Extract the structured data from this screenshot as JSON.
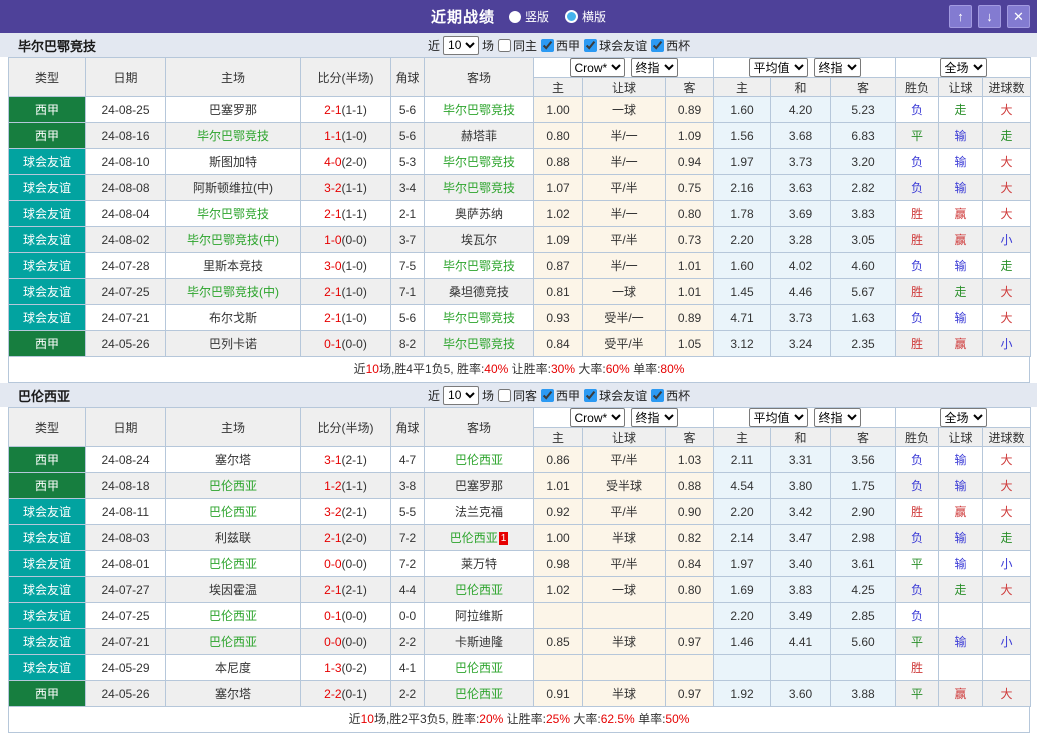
{
  "titlebar": {
    "title": "近期战绩",
    "view_options": [
      {
        "label": "竖版",
        "selected": true
      },
      {
        "label": "横版",
        "selected": false
      }
    ],
    "buttons": {
      "up": "↑",
      "down": "↓",
      "close": "✕"
    }
  },
  "table_header": {
    "static_cols": [
      "类型",
      "日期",
      "主场",
      "比分(半场)",
      "角球",
      "客场"
    ],
    "odds_source": "Crow*",
    "odds_stage": "终指",
    "avg_source": "平均值",
    "avg_stage": "终指",
    "scope": "全场",
    "odds_cols": [
      "主",
      "让球",
      "客"
    ],
    "avg_cols": [
      "主",
      "和",
      "客"
    ],
    "result_cols": [
      "胜负",
      "让球",
      "进球数"
    ]
  },
  "colors": {
    "accent_bar": "#4e4199",
    "type_badge": {
      "西甲": "#177e3f",
      "球会友谊": "#02a3a0"
    },
    "team_highlight": "#2ca42c",
    "score_red": "#e60000"
  },
  "sections": [
    {
      "team": "毕尔巴鄂竞技",
      "filter": {
        "near": "近",
        "count": "10",
        "unit": "场",
        "venue": {
          "label": "同主",
          "checked": false
        },
        "leagues": [
          {
            "label": "西甲",
            "checked": true
          },
          {
            "label": "球会友谊",
            "checked": true
          },
          {
            "label": "西杯",
            "checked": true
          }
        ]
      },
      "rows": [
        {
          "type": "西甲",
          "date": "24-08-25",
          "home": "巴塞罗那",
          "home_hl": false,
          "score": "2-1",
          "half": "(1-1)",
          "corner": "5-6",
          "away": "毕尔巴鄂竞技",
          "away_hl": true,
          "odds": [
            "1.00",
            "一球",
            "0.89"
          ],
          "avg": [
            "1.60",
            "4.20",
            "5.23"
          ],
          "results": [
            [
              "负",
              "blue"
            ],
            [
              "走",
              "green"
            ],
            [
              "大",
              "red"
            ]
          ]
        },
        {
          "type": "西甲",
          "date": "24-08-16",
          "home": "毕尔巴鄂竞技",
          "home_hl": true,
          "score": "1-1",
          "half": "(1-0)",
          "corner": "5-6",
          "away": "赫塔菲",
          "away_hl": false,
          "odds": [
            "0.80",
            "半/一",
            "1.09"
          ],
          "avg": [
            "1.56",
            "3.68",
            "6.83"
          ],
          "results": [
            [
              "平",
              "green"
            ],
            [
              "输",
              "blue"
            ],
            [
              "走",
              "green"
            ]
          ]
        },
        {
          "type": "球会友谊",
          "date": "24-08-10",
          "home": "斯图加特",
          "home_hl": false,
          "score": "4-0",
          "half": "(2-0)",
          "corner": "5-3",
          "away": "毕尔巴鄂竞技",
          "away_hl": true,
          "odds": [
            "0.88",
            "半/一",
            "0.94"
          ],
          "avg": [
            "1.97",
            "3.73",
            "3.20"
          ],
          "results": [
            [
              "负",
              "blue"
            ],
            [
              "输",
              "blue"
            ],
            [
              "大",
              "red"
            ]
          ]
        },
        {
          "type": "球会友谊",
          "date": "24-08-08",
          "home": "阿斯顿维拉(中)",
          "home_hl": false,
          "score": "3-2",
          "half": "(1-1)",
          "corner": "3-4",
          "away": "毕尔巴鄂竞技",
          "away_hl": true,
          "odds": [
            "1.07",
            "平/半",
            "0.75"
          ],
          "avg": [
            "2.16",
            "3.63",
            "2.82"
          ],
          "results": [
            [
              "负",
              "blue"
            ],
            [
              "输",
              "blue"
            ],
            [
              "大",
              "red"
            ]
          ]
        },
        {
          "type": "球会友谊",
          "date": "24-08-04",
          "home": "毕尔巴鄂竞技",
          "home_hl": true,
          "score": "2-1",
          "half": "(1-1)",
          "corner": "2-1",
          "away": "奥萨苏纳",
          "away_hl": false,
          "odds": [
            "1.02",
            "半/一",
            "0.80"
          ],
          "avg": [
            "1.78",
            "3.69",
            "3.83"
          ],
          "results": [
            [
              "胜",
              "red"
            ],
            [
              "赢",
              "red"
            ],
            [
              "大",
              "red"
            ]
          ]
        },
        {
          "type": "球会友谊",
          "date": "24-08-02",
          "home": "毕尔巴鄂竞技(中)",
          "home_hl": true,
          "score": "1-0",
          "half": "(0-0)",
          "corner": "3-7",
          "away": "埃瓦尔",
          "away_hl": false,
          "odds": [
            "1.09",
            "平/半",
            "0.73"
          ],
          "avg": [
            "2.20",
            "3.28",
            "3.05"
          ],
          "results": [
            [
              "胜",
              "red"
            ],
            [
              "赢",
              "red"
            ],
            [
              "小",
              "blue"
            ]
          ]
        },
        {
          "type": "球会友谊",
          "date": "24-07-28",
          "home": "里斯本竞技",
          "home_hl": false,
          "score": "3-0",
          "half": "(1-0)",
          "corner": "7-5",
          "away": "毕尔巴鄂竞技",
          "away_hl": true,
          "odds": [
            "0.87",
            "半/一",
            "1.01"
          ],
          "avg": [
            "1.60",
            "4.02",
            "4.60"
          ],
          "results": [
            [
              "负",
              "blue"
            ],
            [
              "输",
              "blue"
            ],
            [
              "走",
              "green"
            ]
          ]
        },
        {
          "type": "球会友谊",
          "date": "24-07-25",
          "home": "毕尔巴鄂竞技(中)",
          "home_hl": true,
          "score": "2-1",
          "half": "(1-0)",
          "corner": "7-1",
          "away": "桑坦德竞技",
          "away_hl": false,
          "odds": [
            "0.81",
            "一球",
            "1.01"
          ],
          "avg": [
            "1.45",
            "4.46",
            "5.67"
          ],
          "results": [
            [
              "胜",
              "red"
            ],
            [
              "走",
              "green"
            ],
            [
              "大",
              "red"
            ]
          ]
        },
        {
          "type": "球会友谊",
          "date": "24-07-21",
          "home": "布尔戈斯",
          "home_hl": false,
          "score": "2-1",
          "half": "(1-0)",
          "corner": "5-6",
          "away": "毕尔巴鄂竞技",
          "away_hl": true,
          "odds": [
            "0.93",
            "受半/一",
            "0.89"
          ],
          "avg": [
            "4.71",
            "3.73",
            "1.63"
          ],
          "results": [
            [
              "负",
              "blue"
            ],
            [
              "输",
              "blue"
            ],
            [
              "大",
              "red"
            ]
          ]
        },
        {
          "type": "西甲",
          "date": "24-05-26",
          "home": "巴列卡诺",
          "home_hl": false,
          "score": "0-1",
          "half": "(0-0)",
          "corner": "8-2",
          "away": "毕尔巴鄂竞技",
          "away_hl": true,
          "odds": [
            "0.84",
            "受平/半",
            "1.05"
          ],
          "avg": [
            "3.12",
            "3.24",
            "2.35"
          ],
          "results": [
            [
              "胜",
              "red"
            ],
            [
              "赢",
              "red"
            ],
            [
              "小",
              "blue"
            ]
          ]
        }
      ],
      "summary": [
        [
          "近",
          false
        ],
        [
          "10",
          true
        ],
        [
          "场,胜4平1负5, 胜率:",
          false
        ],
        [
          "40%",
          true
        ],
        [
          " 让胜率:",
          false
        ],
        [
          "30%",
          true
        ],
        [
          " 大率:",
          false
        ],
        [
          "60%",
          true
        ],
        [
          " 单率:",
          false
        ],
        [
          "80%",
          true
        ]
      ]
    },
    {
      "team": "巴伦西亚",
      "filter": {
        "near": "近",
        "count": "10",
        "unit": "场",
        "venue": {
          "label": "同客",
          "checked": false
        },
        "leagues": [
          {
            "label": "西甲",
            "checked": true
          },
          {
            "label": "球会友谊",
            "checked": true
          },
          {
            "label": "西杯",
            "checked": true
          }
        ]
      },
      "rows": [
        {
          "type": "西甲",
          "date": "24-08-24",
          "home": "塞尔塔",
          "home_hl": false,
          "score": "3-1",
          "half": "(2-1)",
          "corner": "4-7",
          "away": "巴伦西亚",
          "away_hl": true,
          "odds": [
            "0.86",
            "平/半",
            "1.03"
          ],
          "avg": [
            "2.11",
            "3.31",
            "3.56"
          ],
          "results": [
            [
              "负",
              "blue"
            ],
            [
              "输",
              "blue"
            ],
            [
              "大",
              "red"
            ]
          ]
        },
        {
          "type": "西甲",
          "date": "24-08-18",
          "home": "巴伦西亚",
          "home_hl": true,
          "score": "1-2",
          "half": "(1-1)",
          "corner": "3-8",
          "away": "巴塞罗那",
          "away_hl": false,
          "odds": [
            "1.01",
            "受半球",
            "0.88"
          ],
          "avg": [
            "4.54",
            "3.80",
            "1.75"
          ],
          "results": [
            [
              "负",
              "blue"
            ],
            [
              "输",
              "blue"
            ],
            [
              "大",
              "red"
            ]
          ]
        },
        {
          "type": "球会友谊",
          "date": "24-08-11",
          "home": "巴伦西亚",
          "home_hl": true,
          "score": "3-2",
          "half": "(2-1)",
          "corner": "5-5",
          "away": "法兰克福",
          "away_hl": false,
          "odds": [
            "0.92",
            "平/半",
            "0.90"
          ],
          "avg": [
            "2.20",
            "3.42",
            "2.90"
          ],
          "results": [
            [
              "胜",
              "red"
            ],
            [
              "赢",
              "red"
            ],
            [
              "大",
              "red"
            ]
          ]
        },
        {
          "type": "球会友谊",
          "date": "24-08-03",
          "home": "利兹联",
          "home_hl": false,
          "score": "2-1",
          "half": "(2-0)",
          "corner": "7-2",
          "away": "巴伦西亚",
          "away_hl": true,
          "away_badge": "1",
          "odds": [
            "1.00",
            "半球",
            "0.82"
          ],
          "avg": [
            "2.14",
            "3.47",
            "2.98"
          ],
          "results": [
            [
              "负",
              "blue"
            ],
            [
              "输",
              "blue"
            ],
            [
              "走",
              "green"
            ]
          ]
        },
        {
          "type": "球会友谊",
          "date": "24-08-01",
          "home": "巴伦西亚",
          "home_hl": true,
          "score": "0-0",
          "half": "(0-0)",
          "corner": "7-2",
          "away": "莱万特",
          "away_hl": false,
          "odds": [
            "0.98",
            "平/半",
            "0.84"
          ],
          "avg": [
            "1.97",
            "3.40",
            "3.61"
          ],
          "results": [
            [
              "平",
              "green"
            ],
            [
              "输",
              "blue"
            ],
            [
              "小",
              "blue"
            ]
          ]
        },
        {
          "type": "球会友谊",
          "date": "24-07-27",
          "home": "埃因霍温",
          "home_hl": false,
          "score": "2-1",
          "half": "(2-1)",
          "corner": "4-4",
          "away": "巴伦西亚",
          "away_hl": true,
          "odds": [
            "1.02",
            "一球",
            "0.80"
          ],
          "avg": [
            "1.69",
            "3.83",
            "4.25"
          ],
          "results": [
            [
              "负",
              "blue"
            ],
            [
              "走",
              "green"
            ],
            [
              "大",
              "red"
            ]
          ]
        },
        {
          "type": "球会友谊",
          "date": "24-07-25",
          "home": "巴伦西亚",
          "home_hl": true,
          "score": "0-1",
          "half": "(0-0)",
          "corner": "0-0",
          "away": "阿拉维斯",
          "away_hl": false,
          "odds": [
            "",
            "",
            ""
          ],
          "avg": [
            "2.20",
            "3.49",
            "2.85"
          ],
          "results": [
            [
              "负",
              "blue"
            ],
            [
              "",
              ""
            ],
            [
              "",
              ""
            ]
          ]
        },
        {
          "type": "球会友谊",
          "date": "24-07-21",
          "home": "巴伦西亚",
          "home_hl": true,
          "score": "0-0",
          "half": "(0-0)",
          "corner": "2-2",
          "away": "卡斯迪隆",
          "away_hl": false,
          "odds": [
            "0.85",
            "半球",
            "0.97"
          ],
          "avg": [
            "1.46",
            "4.41",
            "5.60"
          ],
          "results": [
            [
              "平",
              "green"
            ],
            [
              "输",
              "blue"
            ],
            [
              "小",
              "blue"
            ]
          ]
        },
        {
          "type": "球会友谊",
          "date": "24-05-29",
          "home": "本尼度",
          "home_hl": false,
          "score": "1-3",
          "half": "(0-2)",
          "corner": "4-1",
          "away": "巴伦西亚",
          "away_hl": true,
          "odds": [
            "",
            "",
            ""
          ],
          "avg": [
            "",
            "",
            ""
          ],
          "results": [
            [
              "胜",
              "red"
            ],
            [
              "",
              ""
            ],
            [
              "",
              ""
            ]
          ]
        },
        {
          "type": "西甲",
          "date": "24-05-26",
          "home": "塞尔塔",
          "home_hl": false,
          "score": "2-2",
          "half": "(0-1)",
          "corner": "2-2",
          "away": "巴伦西亚",
          "away_hl": true,
          "odds": [
            "0.91",
            "半球",
            "0.97"
          ],
          "avg": [
            "1.92",
            "3.60",
            "3.88"
          ],
          "results": [
            [
              "平",
              "green"
            ],
            [
              "赢",
              "red"
            ],
            [
              "大",
              "red"
            ]
          ]
        }
      ],
      "summary": [
        [
          "近",
          false
        ],
        [
          "10",
          true
        ],
        [
          "场,胜2平3负5, 胜率:",
          false
        ],
        [
          "20%",
          true
        ],
        [
          " 让胜率:",
          false
        ],
        [
          "25%",
          true
        ],
        [
          " 大率:",
          false
        ],
        [
          "62.5%",
          true
        ],
        [
          " 单率:",
          false
        ],
        [
          "50%",
          true
        ]
      ]
    }
  ]
}
